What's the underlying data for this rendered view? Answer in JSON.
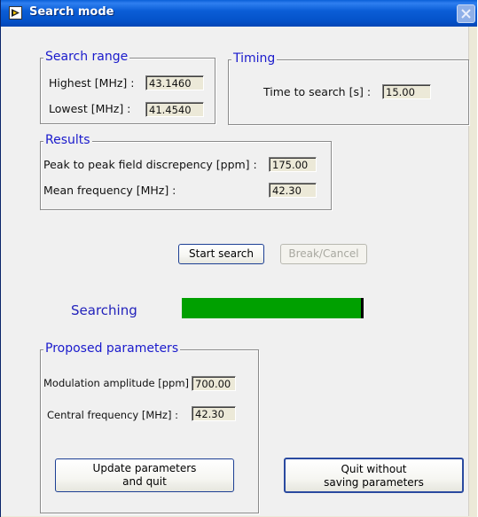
{
  "window": {
    "title": "Search mode"
  },
  "search_range": {
    "legend": "Search range",
    "highest_label": "Highest [MHz] :",
    "highest_value": "43.1460",
    "lowest_label": "Lowest [MHz] :",
    "lowest_value": "41.4540"
  },
  "timing": {
    "legend": "Timing",
    "time_label": "Time to search [s] :",
    "time_value": "15.00"
  },
  "results": {
    "legend": "Results",
    "peak_label": "Peak to peak field discrepency [ppm] :",
    "peak_value": "175.00",
    "mean_label": "Mean frequency [MHz] :",
    "mean_value": "42.30"
  },
  "buttons": {
    "start_search": "Start search",
    "break_cancel": "Break/Cancel",
    "update_line1": "Update parameters",
    "update_line2": "and quit",
    "quit_line1": "Quit without",
    "quit_line2": "saving parameters"
  },
  "status": {
    "searching_label": "Searching",
    "progress_fraction": 1.0,
    "progress_color": "#00a000"
  },
  "proposed": {
    "legend": "Proposed parameters",
    "modulation_label": "Modulation amplitude [ppm] :",
    "modulation_value": "700.00",
    "central_label": "Central frequency [MHz] :",
    "central_value": "42.30"
  },
  "colors": {
    "titlebar": "#0b5ed7",
    "legend_text": "#1a1acc",
    "button_border": "#1c3f94"
  }
}
